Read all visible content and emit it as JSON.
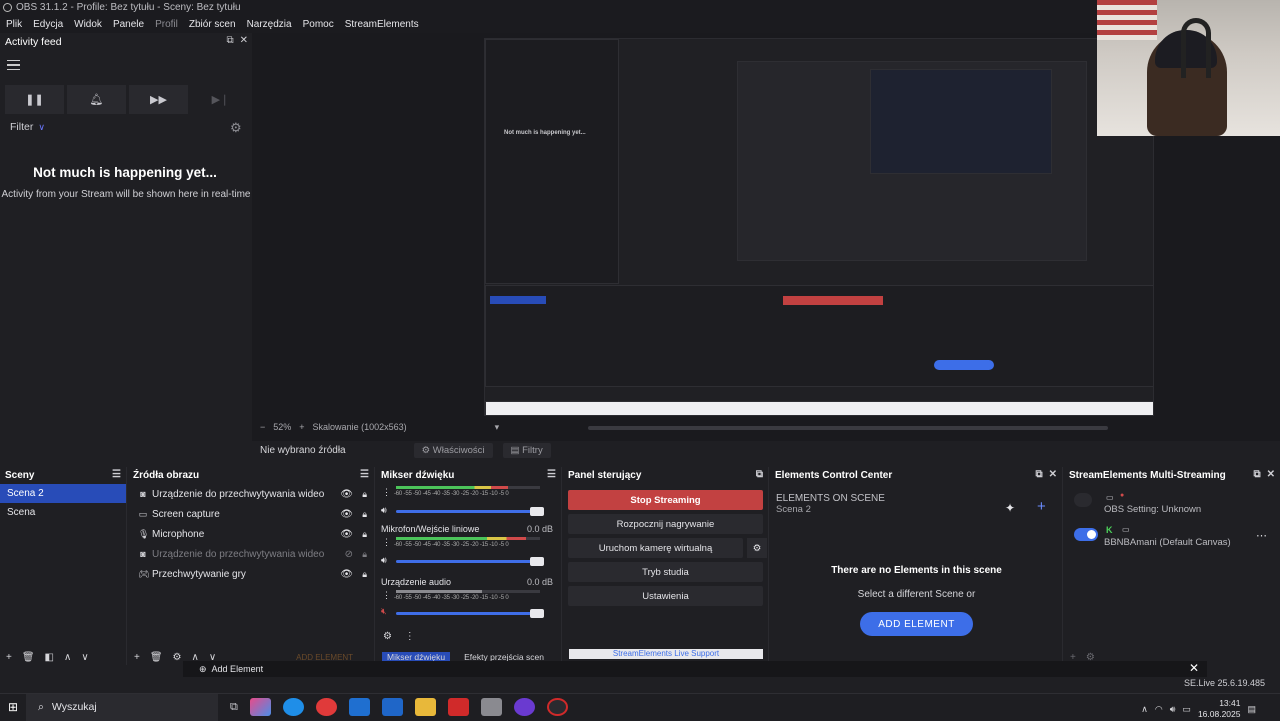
{
  "window": {
    "title": "OBS 31.1.2 - Profile: Bez tytułu - Sceny: Bez tytułu"
  },
  "menu": [
    "Plik",
    "Edycja",
    "Widok",
    "Panele",
    "Profil",
    "Zbiór scen",
    "Narzędzia",
    "Pomoc",
    "StreamElements"
  ],
  "activity_feed": {
    "title": "Activity feed",
    "filter_label": "Filter",
    "empty_title": "Not much is happening yet...",
    "empty_subtitle": "Activity from your Stream will be shown here in real-time"
  },
  "preview": {
    "zoom": "52%",
    "scaling": "Skalowanie (1002x563)"
  },
  "source_toolbar": {
    "no_source": "Nie wybrano źródła",
    "properties": "Właściwości",
    "filters": "Filtry"
  },
  "scenes": {
    "title": "Sceny",
    "items": [
      {
        "label": "Scena 2",
        "selected": true
      },
      {
        "label": "Scena",
        "selected": false
      }
    ]
  },
  "sources": {
    "title": "Źródła obrazu",
    "items": [
      {
        "label": "Urządzenie do przechwytywania wideo",
        "icon": "camera-icon",
        "visible": true
      },
      {
        "label": "Screen capture",
        "icon": "monitor-icon",
        "visible": true
      },
      {
        "label": "Microphone",
        "icon": "microphone-icon",
        "visible": true
      },
      {
        "label": "Urządzenie do przechwytywania wideo",
        "icon": "camera-icon",
        "visible": false
      },
      {
        "label": "Przechwytywanie gry",
        "icon": "gamepad-icon",
        "visible": true
      }
    ],
    "footer_add": "ADD ELEMENT"
  },
  "mixer": {
    "title": "Mikser dźwięku",
    "scale": "-60 -55 -50 -45 -40 -35 -30 -25 -20 -15 -10 -5 0",
    "channels": [
      {
        "name": "",
        "db": "",
        "level": 0.78
      },
      {
        "name": "Mikrofon/Wejście liniowe",
        "db": "0.0 dB",
        "level": 0.9
      },
      {
        "name": "Urządzenie audio",
        "db": "0.0 dB",
        "level": 0.6
      }
    ],
    "footer_tab": "Mikser dźwięku",
    "footer_tab2": "Efekty przejścia scen"
  },
  "control_panel": {
    "title": "Panel sterujący",
    "stop_streaming": "Stop Streaming",
    "start_recording": "Rozpocznij nagrywanie",
    "virtual_camera": "Uruchom kamerę wirtualną",
    "studio_mode": "Tryb studia",
    "settings": "Ustawienia",
    "live_support": "StreamElements Live Support"
  },
  "elements_center": {
    "title": "Elements Control Center",
    "on_scene": "ELEMENTS ON SCENE",
    "scene": "Scena 2",
    "empty_title": "There are no Elements in this scene",
    "empty_sub": "Select a different Scene or",
    "add_button": "ADD ELEMENT"
  },
  "multistream": {
    "title": "StreamElements Multi-Streaming",
    "obs_setting": "OBS Setting: Unknown",
    "account": "BBNBAmani (Default Canvas)"
  },
  "add_element_bar": {
    "label": "Add Element"
  },
  "status": {
    "live": "SE.Live 25.6.19.485"
  },
  "taskbar": {
    "search": "Wyszukaj",
    "time": "13:41",
    "date": "16.08.2025"
  },
  "colors": {
    "accent": "#3d6ee8",
    "stop": "#c24141",
    "scene_selected": "#284cb8"
  }
}
